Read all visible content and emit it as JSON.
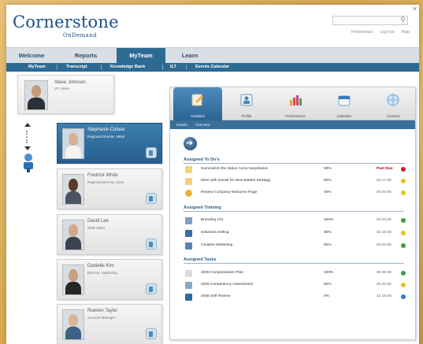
{
  "colors": {
    "brand": "#1e4e86",
    "nav": "#2d6b93",
    "overdue": "#b00000"
  },
  "header": {
    "logo": "Cornerstone",
    "logo_sub": "OnDemand",
    "search_placeholder": "",
    "links": [
      "Preferences",
      "Log Out",
      "Help"
    ]
  },
  "mainnav": {
    "tabs": [
      "Welcome",
      "Reports",
      "MyTeam",
      "Learn"
    ]
  },
  "subnav": {
    "items": [
      "MyTeam",
      "Transcript",
      "Knowledge Bank",
      "ILT",
      "Events Calendar"
    ]
  },
  "manager": {
    "name": "Steve Johnson",
    "role": "VP, Sales"
  },
  "team": [
    {
      "name": "Stephanie Colose",
      "role": "Regional Director, West"
    },
    {
      "name": "Fredrick White",
      "role": "Regional Director, East"
    },
    {
      "name": "David Lee",
      "role": "SMB Sales"
    },
    {
      "name": "Danielle Kim",
      "role": "Director, Marketing"
    },
    {
      "name": "Rueven Taylor",
      "role": "Account Manager"
    }
  ],
  "panel": {
    "tabs": [
      "Activities",
      "Profile",
      "Performance",
      "Calendar",
      "Connect"
    ],
    "subtabs": [
      "Details",
      "Overview"
    ],
    "sections": [
      {
        "title": "Assigned To Do's",
        "rows": [
          {
            "name": "Summarize the status Acme Negotiation",
            "pct": "50%",
            "date": "Past Due",
            "status": "red"
          },
          {
            "name": "Meet with Daniel for New Market Strategy",
            "pct": "50%",
            "date": "03.17.08",
            "status": "yellow"
          },
          {
            "name": "Review Company Welcome Page",
            "pct": "40%",
            "date": "03.20.08",
            "status": "yellow"
          }
        ]
      },
      {
        "title": "Assigned Training",
        "rows": [
          {
            "name": "Branding 101",
            "pct": "100%",
            "date": "03.03.08",
            "status": "green"
          },
          {
            "name": "Solutions Selling",
            "pct": "80%",
            "date": "03.15.08",
            "status": "yellow"
          },
          {
            "name": "Creative Marketing",
            "pct": "60%",
            "date": "04.22.08",
            "status": "green"
          }
        ]
      },
      {
        "title": "Assigned Tasks",
        "rows": [
          {
            "name": "2008 Compensation Plan",
            "pct": "100%",
            "date": "05.20.08",
            "status": "green"
          },
          {
            "name": "2008 Competency Assessment",
            "pct": "50%",
            "date": "05.20.08",
            "status": "yellow"
          },
          {
            "name": "2008 Self Review",
            "pct": "0%",
            "date": "12.15.08",
            "status": "blue"
          }
        ]
      }
    ]
  }
}
